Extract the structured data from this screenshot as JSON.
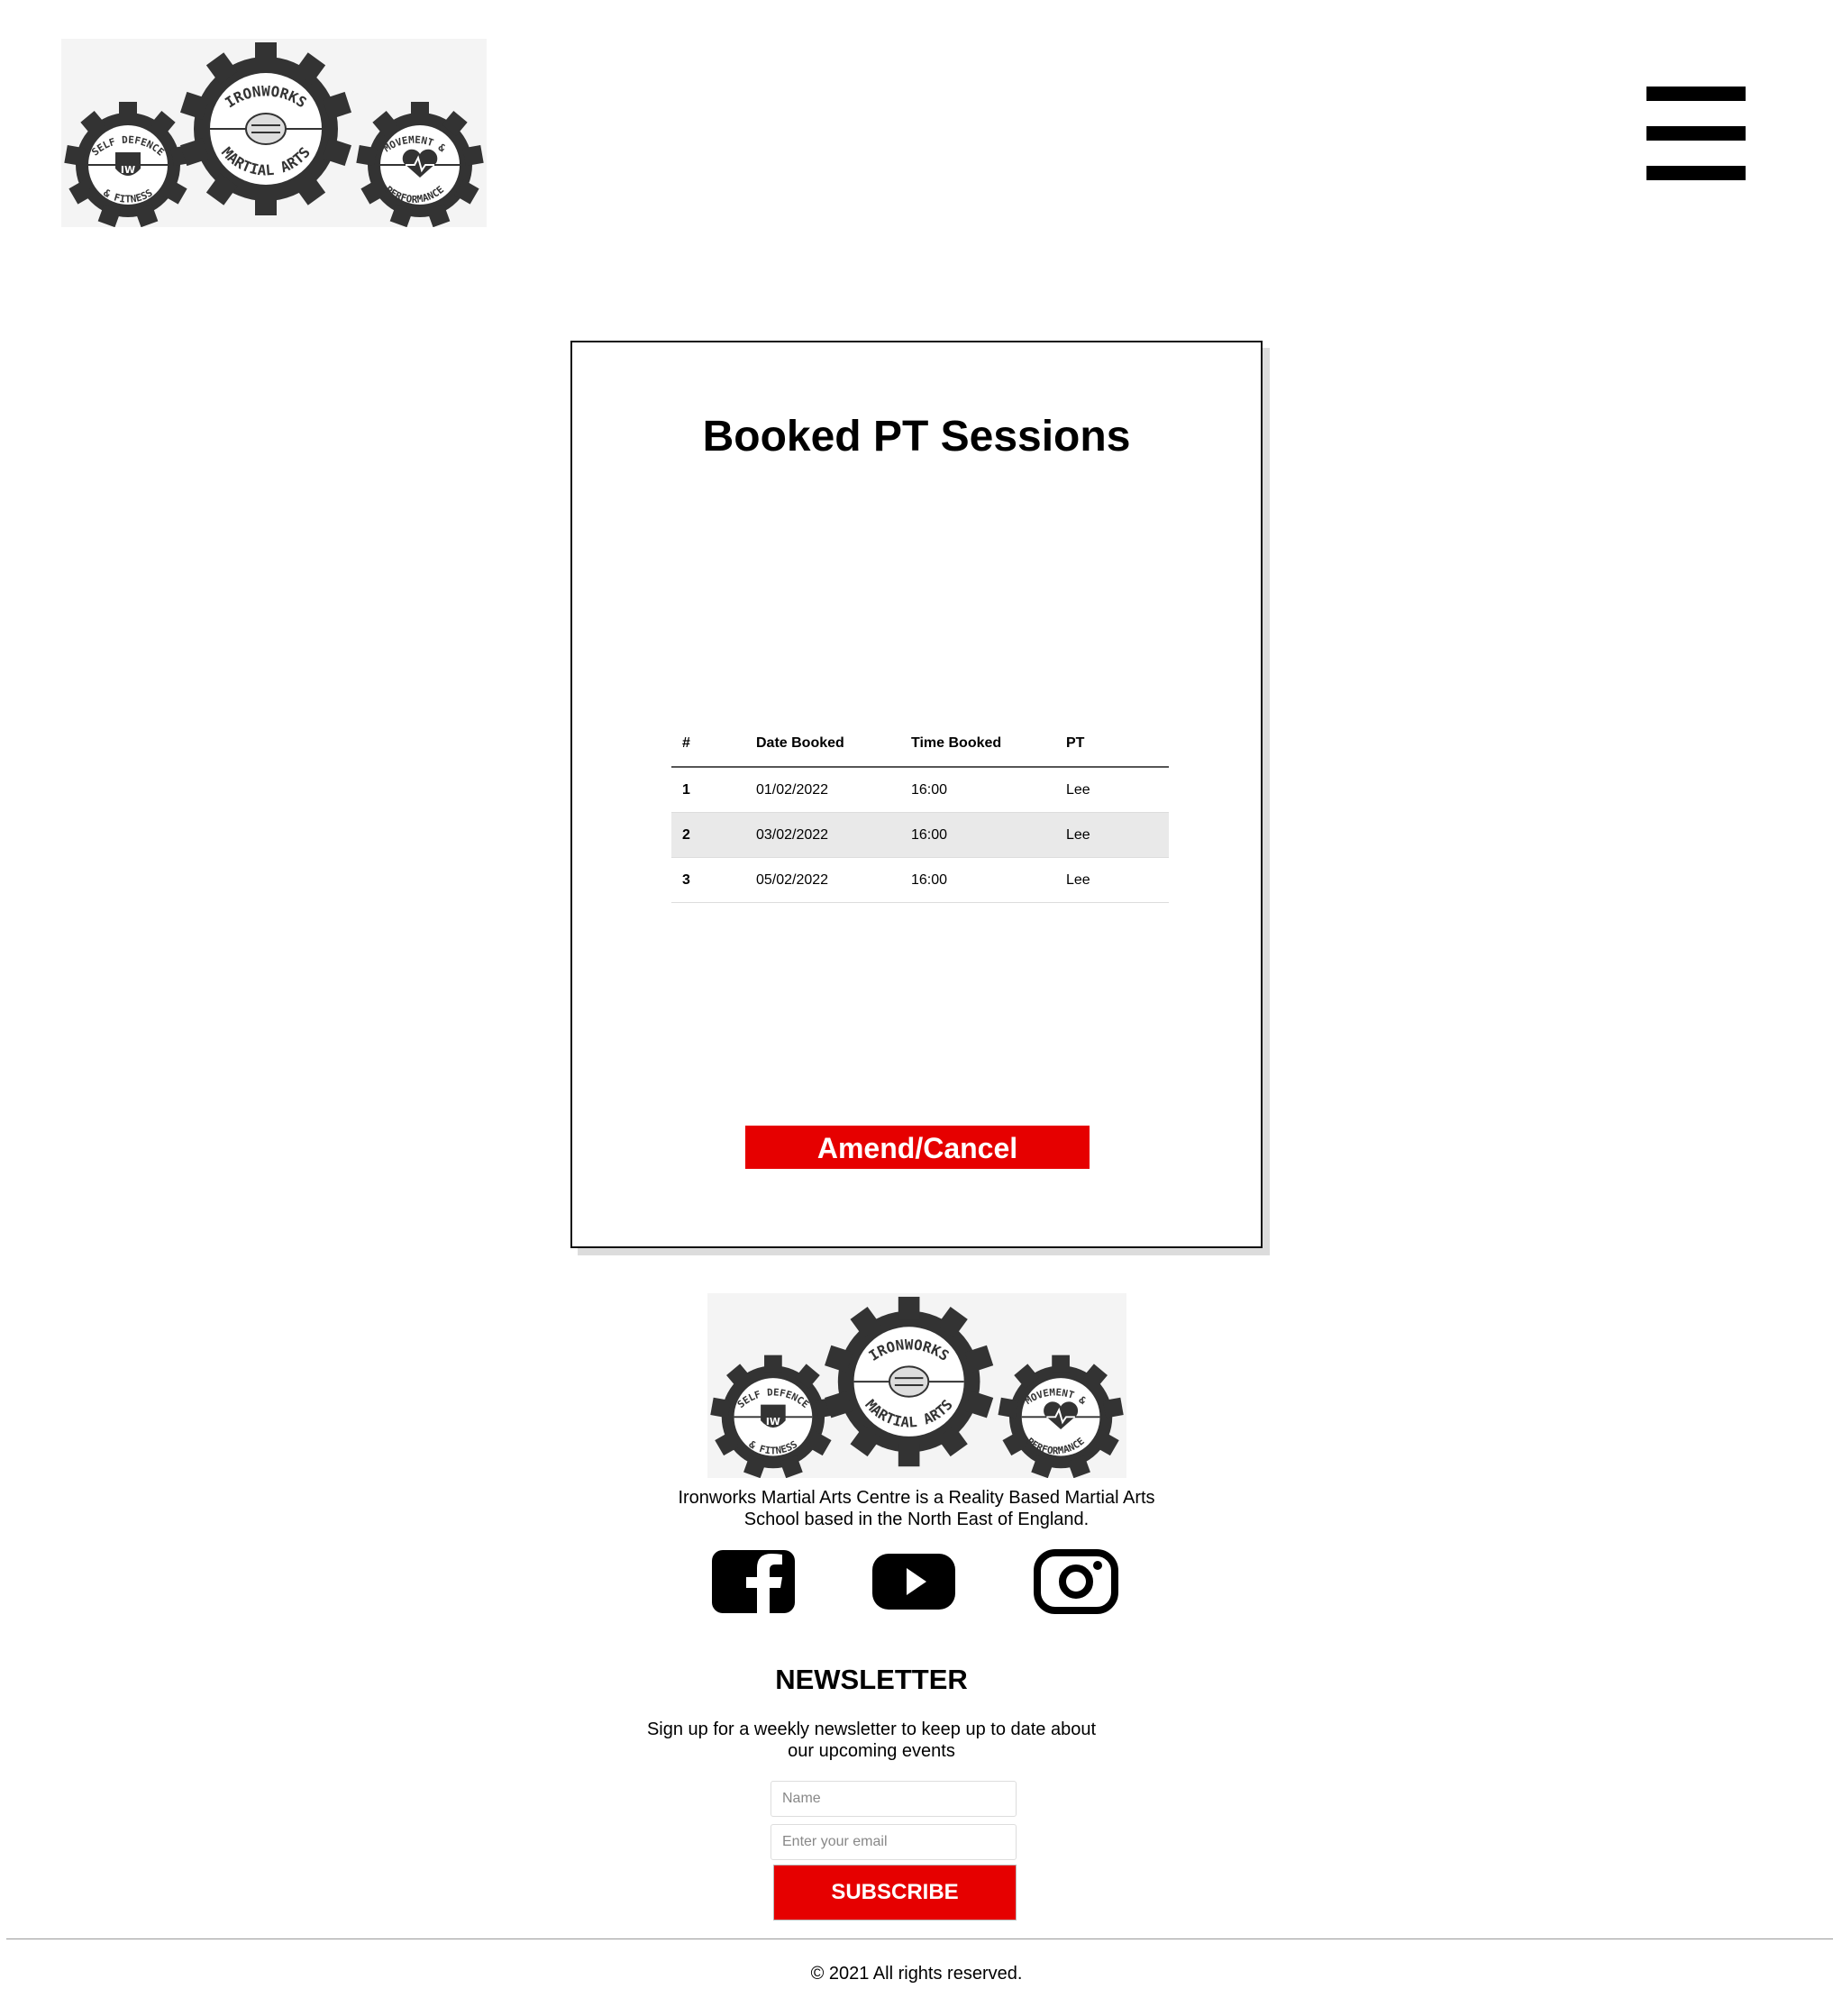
{
  "header": {
    "logo_alt": "Ironworks Martial Arts logo",
    "logo_text": {
      "center_top": "IRONWORKS",
      "center_bottom": "MARTIAL ARTS",
      "left_top": "SELF DEFENCE",
      "left_bottom": "& FITNESS",
      "left_badge": "IW",
      "right_top": "MOVEMENT &",
      "right_bottom": "PERFORMANCE"
    },
    "menu_icon": "hamburger-menu-icon"
  },
  "bookings": {
    "title": "Booked PT Sessions",
    "columns": [
      "#",
      "Date Booked",
      "Time Booked",
      "PT"
    ],
    "rows": [
      [
        "1",
        "01/02/2022",
        "16:00",
        "Lee"
      ],
      [
        "2",
        "03/02/2022",
        "16:00",
        "Lee"
      ],
      [
        "3",
        "05/02/2022",
        "16:00",
        "Lee"
      ]
    ],
    "amend_label": "Amend/Cancel"
  },
  "footer": {
    "about": "Ironworks Martial Arts Centre is a Reality Based Martial Arts School based in the North East of England.",
    "social": [
      {
        "icon": "facebook-icon"
      },
      {
        "icon": "youtube-icon"
      },
      {
        "icon": "instagram-icon"
      }
    ],
    "newsletter": {
      "title": "NEWSLETTER",
      "description": "Sign up for a weekly newsletter to keep up to date about our upcoming events",
      "name_placeholder": "Name",
      "email_placeholder": "Enter your email",
      "subscribe_label": "SUBSCRIBE"
    },
    "copyright": "© 2021 All rights reserved."
  },
  "colors": {
    "accent": "#e60000",
    "logo_gray": "#333333",
    "stripe": "#e9e9e9"
  }
}
